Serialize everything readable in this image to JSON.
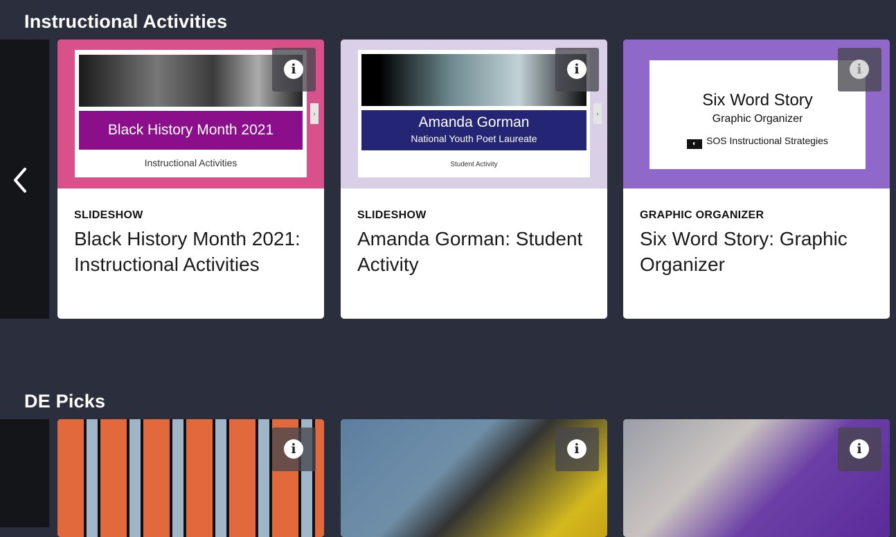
{
  "sections": [
    {
      "title": "Instructional Activities",
      "cards": [
        {
          "type": "SLIDESHOW",
          "title": "Black History Month 2021: Instructional Activities",
          "thumb": {
            "banner": "Black History Month 2021",
            "subtitle": "Instructional Activities",
            "next_tab": "›"
          },
          "info_icon": "i"
        },
        {
          "type": "SLIDESHOW",
          "title": "Amanda Gorman: Student Activity",
          "thumb": {
            "banner_line1": "Amanda Gorman",
            "banner_line2": "National Youth Poet Laureate",
            "subtitle": "Student Activity",
            "next_tab": "›"
          },
          "info_icon": "i"
        },
        {
          "type": "GRAPHIC ORGANIZER",
          "title": "Six Word Story: Graphic Organizer",
          "thumb": {
            "line1": "Six Word Story",
            "line2": "Graphic Organizer",
            "line3": "SOS Instructional Strategies"
          },
          "info_icon": "i"
        }
      ]
    },
    {
      "title": "DE Picks",
      "cards": [
        {
          "info_icon": "i"
        },
        {
          "info_icon": "i"
        },
        {
          "info_icon": "i"
        }
      ]
    }
  ],
  "nav": {
    "prev_icon": "chevron-left-icon"
  },
  "colors": {
    "background": "#2b2f3d",
    "rail": "#141519",
    "accent_pink": "#d8518b",
    "accent_purple": "#9068c9",
    "banner_magenta": "#8b0f8b",
    "banner_navy": "#242575"
  }
}
